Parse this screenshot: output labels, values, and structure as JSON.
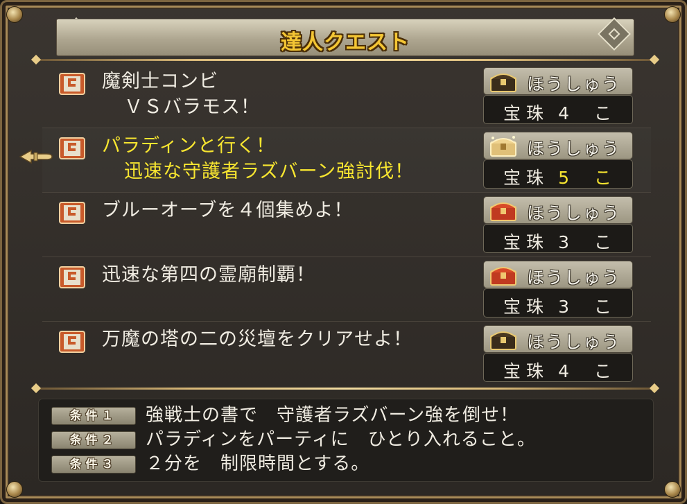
{
  "window": {
    "title": "達人クエスト"
  },
  "colors": {
    "selected_text": "#f8e630",
    "normal_text": "#f0ece2",
    "title_text": "#f4c634"
  },
  "quests": [
    {
      "name_line1": "魔剣士コンビ",
      "name_line2": "ＶＳバラモス！",
      "reward_label": "ほうしゅう",
      "reward_item": "宝珠",
      "reward_count": "4 こ",
      "chest": "dark-chest-icon",
      "selected": false
    },
    {
      "name_line1": "パラディンと行く！",
      "name_line2": "迅速な守護者ラズバーン強討伐！",
      "reward_label": "ほうしゅう",
      "reward_item": "宝珠",
      "reward_count": "5 こ",
      "chest": "gold-chest-icon",
      "selected": true
    },
    {
      "name_line1": "ブルーオーブを４個集めよ！",
      "name_line2": "",
      "reward_label": "ほうしゅう",
      "reward_item": "宝珠",
      "reward_count": "3 こ",
      "chest": "red-chest-icon",
      "selected": false
    },
    {
      "name_line1": "迅速な第四の霊廟制覇！",
      "name_line2": "",
      "reward_label": "ほうしゅう",
      "reward_item": "宝珠",
      "reward_count": "3 こ",
      "chest": "red-chest-icon",
      "selected": false
    },
    {
      "name_line1": "万魔の塔の二の災壇をクリアせよ！",
      "name_line2": "",
      "reward_label": "ほうしゅう",
      "reward_item": "宝珠",
      "reward_count": "4 こ",
      "chest": "dark-chest-icon",
      "selected": false
    }
  ],
  "conditions": [
    {
      "badge": "条件１",
      "text": "強戦士の書で　守護者ラズバーン強を倒せ！"
    },
    {
      "badge": "条件２",
      "text": "パラディンをパーティに　ひとり入れること。"
    },
    {
      "badge": "条件３",
      "text": "２分を　制限時間とする。"
    }
  ]
}
